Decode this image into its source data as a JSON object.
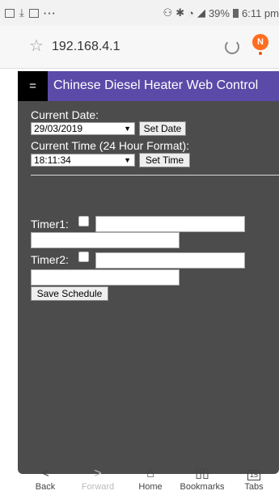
{
  "status_bar": {
    "dots": "···",
    "battery": "39%",
    "time": "6:11 pm"
  },
  "browser": {
    "url": "192.168.4.1",
    "notification_letter": "N"
  },
  "header": {
    "menu_label": "=",
    "title": "Chinese Diesel Heater Web Control"
  },
  "date_section": {
    "label": "Current Date:",
    "value": "29/03/2019",
    "button": "Set Date"
  },
  "time_section": {
    "label": "Current Time (24 Hour Format):",
    "value": "18:11:34",
    "button": "Set Time"
  },
  "timers": [
    {
      "label": "Timer1:",
      "checked": false,
      "value1": "",
      "value2": ""
    },
    {
      "label": "Timer2:",
      "checked": false,
      "value1": "",
      "value2": ""
    }
  ],
  "save_button": "Save Schedule",
  "bottom_nav": {
    "items": [
      {
        "label": "Back",
        "icon": "chevron-left-icon"
      },
      {
        "label": "Forward",
        "icon": "chevron-right-icon"
      },
      {
        "label": "Home",
        "icon": "home-icon"
      },
      {
        "label": "Bookmarks",
        "icon": "bookmarks-icon"
      },
      {
        "label": "Tabs",
        "icon": "tabs-icon",
        "count": "15"
      }
    ]
  },
  "colors": {
    "header": "#5b4aa8",
    "page_bg": "#4c4c4c",
    "menu_button": "#000000",
    "notification": "#ff6d1f"
  }
}
